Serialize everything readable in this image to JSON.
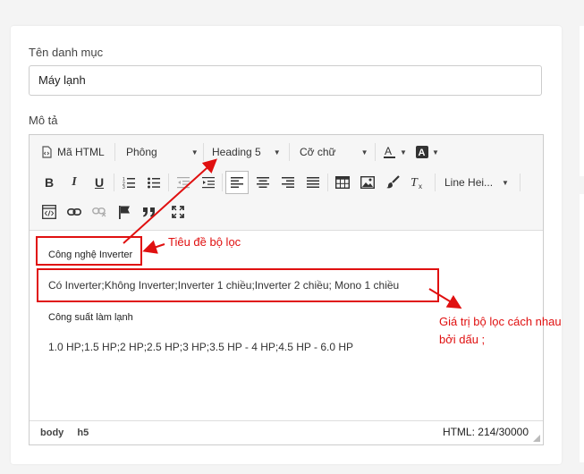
{
  "form": {
    "category_label": "Tên danh mục",
    "category_value": "Máy lạnh",
    "description_label": "Mô tả"
  },
  "toolbar": {
    "html_source": "Mã HTML",
    "font": "Phông",
    "heading": "Heading 5",
    "font_size": "Cỡ chữ",
    "line_height": "Line Hei..."
  },
  "content": {
    "heading1": "Công nghệ Inverter",
    "values1": "Có Inverter;Không Inverter;Inverter 1 chiều;Inverter 2 chiều; Mono 1 chiều",
    "heading2": "Công suất làm lạnh",
    "values2": "1.0 HP;1.5 HP;2 HP;2.5 HP;3 HP;3.5 HP - 4 HP;4.5 HP - 6.0 HP"
  },
  "statusbar": {
    "path": [
      "body",
      "h5"
    ],
    "char_count": "HTML: 214/30000"
  },
  "annotations": {
    "title_note": "Tiêu đề bộ lọc",
    "values_note_line1": "Giá trị bộ lọc cách nhau",
    "values_note_line2": "bởi dấu ;",
    "color": "#e01010"
  }
}
